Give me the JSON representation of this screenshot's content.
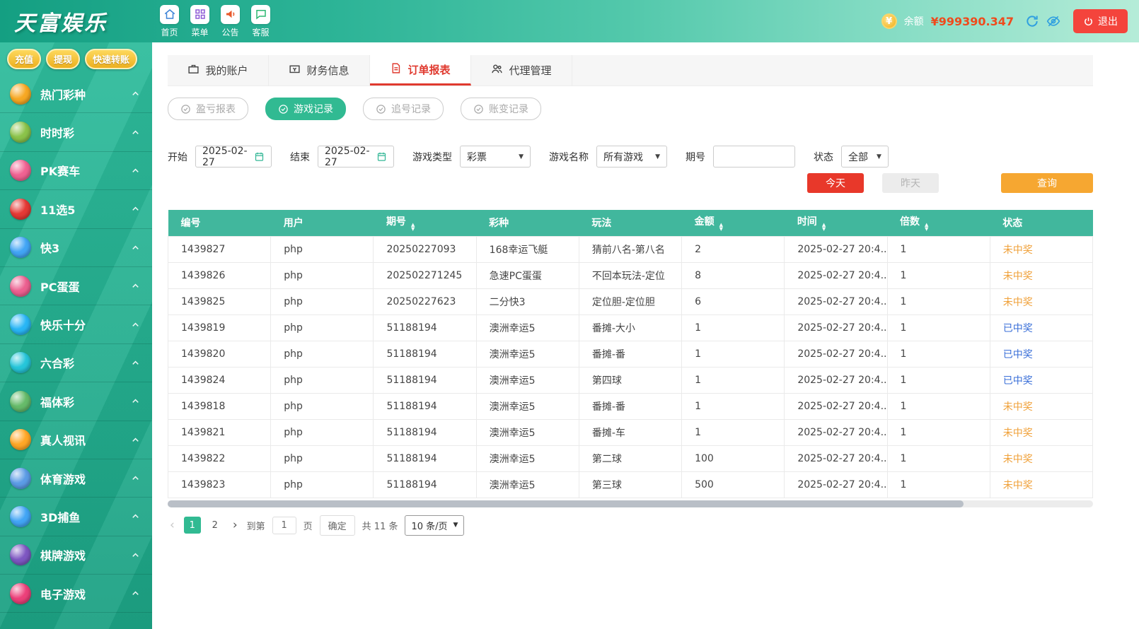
{
  "topbar": {
    "logo": "天富娱乐",
    "nav": [
      {
        "name": "home",
        "label": "首页"
      },
      {
        "name": "menu",
        "label": "菜单"
      },
      {
        "name": "announcement",
        "label": "公告"
      },
      {
        "name": "service",
        "label": "客服"
      }
    ],
    "balance_label": "余额",
    "balance_value": "¥999390.347",
    "logout_label": "退出"
  },
  "sidebar": {
    "quick_buttons": [
      {
        "label": "充值"
      },
      {
        "label": "提现"
      },
      {
        "label": "快速转账"
      }
    ],
    "items": [
      {
        "label": "热门彩种",
        "color": "#f7a823"
      },
      {
        "label": "时时彩",
        "color": "#8bc34a"
      },
      {
        "label": "PK赛车",
        "color": "#f06292"
      },
      {
        "label": "11选5",
        "color": "#e53935"
      },
      {
        "label": "快3",
        "color": "#42a5f5"
      },
      {
        "label": "PC蛋蛋",
        "color": "#ec6090"
      },
      {
        "label": "快乐十分",
        "color": "#29b6f6"
      },
      {
        "label": "六合彩",
        "color": "#26c6da"
      },
      {
        "label": "福体彩",
        "color": "#66bb6a"
      },
      {
        "label": "真人视讯",
        "color": "#ffa726"
      },
      {
        "label": "体育游戏",
        "color": "#5c9ce6"
      },
      {
        "label": "3D捕鱼",
        "color": "#42a5f5"
      },
      {
        "label": "棋牌游戏",
        "color": "#7e57c2"
      },
      {
        "label": "电子游戏",
        "color": "#ec407a"
      }
    ]
  },
  "tabs": [
    {
      "id": "my-account",
      "icon": "account",
      "label": "我的账户",
      "active": false
    },
    {
      "id": "finance-info",
      "icon": "finance",
      "label": "财务信息",
      "active": false
    },
    {
      "id": "order-report",
      "icon": "report",
      "label": "订单报表",
      "active": true
    },
    {
      "id": "agent-manage",
      "icon": "agent",
      "label": "代理管理",
      "active": false
    }
  ],
  "subtabs": [
    {
      "id": "profit-report",
      "label": "盈亏报表",
      "active": false
    },
    {
      "id": "game-records",
      "label": "游戏记录",
      "active": true
    },
    {
      "id": "chase-records",
      "label": "追号记录",
      "active": false
    },
    {
      "id": "account-change-records",
      "label": "账变记录",
      "active": false
    }
  ],
  "filters": {
    "start_label": "开始",
    "start_value": "2025-02-27",
    "end_label": "结束",
    "end_value": "2025-02-27",
    "game_type_label": "游戏类型",
    "game_type_value": "彩票",
    "game_name_label": "游戏名称",
    "game_name_value": "所有游戏",
    "issue_label": "期号",
    "issue_value": "",
    "status_label": "状态",
    "status_value": "全部",
    "today_label": "今天",
    "yesterday_label": "昨天",
    "query_label": "查询"
  },
  "table": {
    "columns": [
      {
        "label": "编号",
        "sortable": false
      },
      {
        "label": "用户",
        "sortable": false
      },
      {
        "label": "期号",
        "sortable": true
      },
      {
        "label": "彩种",
        "sortable": false
      },
      {
        "label": "玩法",
        "sortable": false
      },
      {
        "label": "金额",
        "sortable": true
      },
      {
        "label": "时间",
        "sortable": true
      },
      {
        "label": "倍数",
        "sortable": true
      },
      {
        "label": "状态",
        "sortable": false
      }
    ],
    "rows": [
      {
        "id": "1439827",
        "user": "php",
        "issue": "20250227093",
        "lottery": "168幸运飞艇",
        "play": "猜前八名-第八名",
        "amount": "2",
        "time": "2025-02-27 20:4...",
        "multiple": "1",
        "status": "未中奖",
        "status_type": "pending"
      },
      {
        "id": "1439826",
        "user": "php",
        "issue": "202502271245",
        "lottery": "急速PC蛋蛋",
        "play": "不回本玩法-定位",
        "amount": "8",
        "time": "2025-02-27 20:4...",
        "multiple": "1",
        "status": "未中奖",
        "status_type": "pending"
      },
      {
        "id": "1439825",
        "user": "php",
        "issue": "20250227623",
        "lottery": "二分快3",
        "play": "定位胆-定位胆",
        "amount": "6",
        "time": "2025-02-27 20:4...",
        "multiple": "1",
        "status": "未中奖",
        "status_type": "pending"
      },
      {
        "id": "1439819",
        "user": "php",
        "issue": "51188194",
        "lottery": "澳洲幸运5",
        "play": "番摊-大小",
        "amount": "1",
        "time": "2025-02-27 20:4...",
        "multiple": "1",
        "status": "已中奖",
        "status_type": "win"
      },
      {
        "id": "1439820",
        "user": "php",
        "issue": "51188194",
        "lottery": "澳洲幸运5",
        "play": "番摊-番",
        "amount": "1",
        "time": "2025-02-27 20:4...",
        "multiple": "1",
        "status": "已中奖",
        "status_type": "win"
      },
      {
        "id": "1439824",
        "user": "php",
        "issue": "51188194",
        "lottery": "澳洲幸运5",
        "play": "第四球",
        "amount": "1",
        "time": "2025-02-27 20:4...",
        "multiple": "1",
        "status": "已中奖",
        "status_type": "win"
      },
      {
        "id": "1439818",
        "user": "php",
        "issue": "51188194",
        "lottery": "澳洲幸运5",
        "play": "番摊-番",
        "amount": "1",
        "time": "2025-02-27 20:4...",
        "multiple": "1",
        "status": "未中奖",
        "status_type": "pending"
      },
      {
        "id": "1439821",
        "user": "php",
        "issue": "51188194",
        "lottery": "澳洲幸运5",
        "play": "番摊-车",
        "amount": "1",
        "time": "2025-02-27 20:4...",
        "multiple": "1",
        "status": "未中奖",
        "status_type": "pending"
      },
      {
        "id": "1439822",
        "user": "php",
        "issue": "51188194",
        "lottery": "澳洲幸运5",
        "play": "第二球",
        "amount": "100",
        "time": "2025-02-27 20:4...",
        "multiple": "1",
        "status": "未中奖",
        "status_type": "pending"
      },
      {
        "id": "1439823",
        "user": "php",
        "issue": "51188194",
        "lottery": "澳洲幸运5",
        "play": "第三球",
        "amount": "500",
        "time": "2025-02-27 20:4...",
        "multiple": "1",
        "status": "未中奖",
        "status_type": "pending"
      }
    ]
  },
  "pagination": {
    "pages": [
      "1",
      "2"
    ],
    "active_page": "1",
    "goto_label": "到第",
    "goto_value": "1",
    "page_label": "页",
    "confirm_label": "确定",
    "total_label": "共 11 条",
    "page_size": "10 条/页"
  },
  "colors": {
    "topbar_teal": "#2db497",
    "table_header_teal": "#41b79d",
    "active_tab_red": "#e03a2f",
    "active_subtab_green": "#31ba92",
    "balance_red": "#ef4a1c",
    "status_pending_orange": "#f0a13a",
    "status_win_blue": "#3a6fd8",
    "today_button_red": "#e8382a",
    "query_button_orange": "#f6a731"
  }
}
